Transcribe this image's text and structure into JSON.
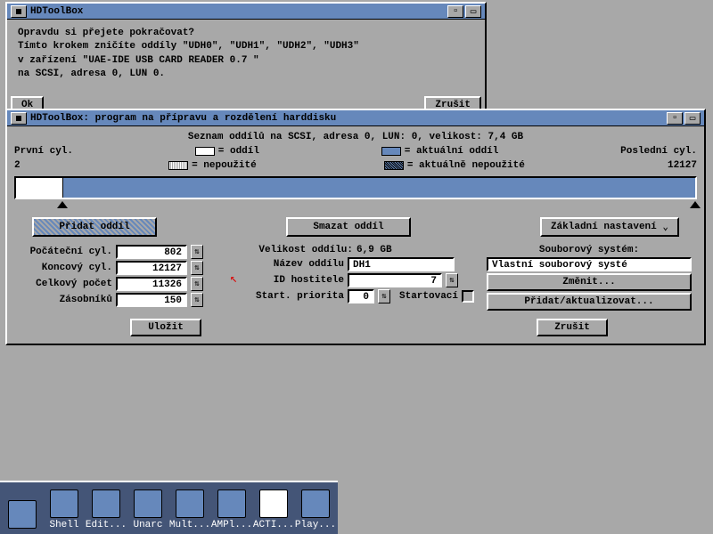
{
  "dialog": {
    "title": "HDToolBox",
    "text_l1": "Opravdu si přejete pokračovat?",
    "text_l2": "Tímto krokem zničíte oddíly \"UDH0\", \"UDH1\", \"UDH2\", \"UDH3\"",
    "text_l3": "v zařízení \"UAE-IDE USB CARD READER 0.7 \"",
    "text_l4": "na SCSI, adresa 0, LUN 0.",
    "ok": "Ok",
    "cancel": "Zrušit"
  },
  "main": {
    "title": "HDToolBox: program na přípravu a rozdělení harddisku",
    "header": "Seznam oddílů na SCSI, adresa 0, LUN: 0, velikost: 7,4 GB",
    "first_cyl_label": "První cyl.",
    "first_cyl_val": "2",
    "last_cyl_label": "Poslední cyl.",
    "last_cyl_val": "12127",
    "legend": {
      "oddil": "= oddíl",
      "nepouzite": "= nepoužité",
      "aktualni": "= aktuální oddíl",
      "aktualne_nepouzite": "= aktuálně nepoužité"
    },
    "buttons": {
      "add": "Přidat oddíl",
      "delete": "Smazat oddíl",
      "basic": "Základní nastavení",
      "save": "Uložit",
      "cancel": "Zrušit",
      "change": "Změnit...",
      "addupdate": "Přidat/aktualizovat..."
    },
    "form": {
      "start_cyl_label": "Počáteční cyl.",
      "start_cyl": "802",
      "end_cyl_label": "Koncový cyl.",
      "end_cyl": "12127",
      "total_label": "Celkový počet",
      "total": "11326",
      "buffers_label": "Zásobníků",
      "buffers": "150",
      "size_label": "Velikost oddílu:",
      "size_val": "6,9 GB",
      "name_label": "Název oddílu",
      "name_val": "DH1",
      "hostid_label": "ID hostitele",
      "hostid_val": "7",
      "priority_label": "Start. priorita",
      "priority_val": "0",
      "bootable_label": "Startovací",
      "fs_label": "Souborový systém:",
      "fs_val": "Vlastní souborový systé"
    }
  },
  "taskbar": {
    "items": [
      "",
      "Shell",
      "Edit...",
      "Unarc",
      "Mult...",
      "AMPl...",
      "ACTI...",
      "Play..."
    ]
  }
}
